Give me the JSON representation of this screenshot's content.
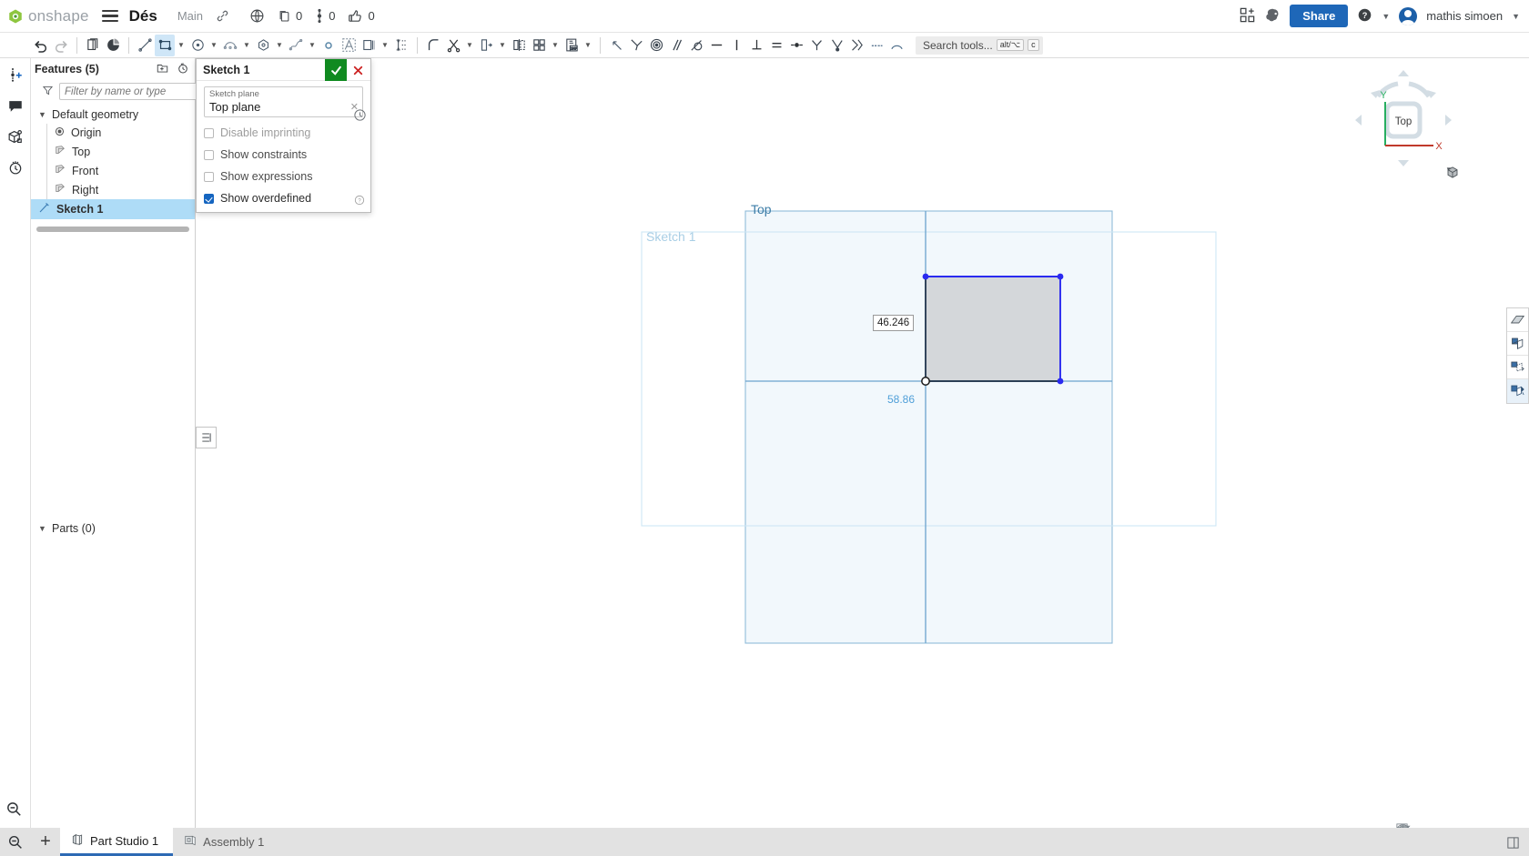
{
  "header": {
    "logo_text": "onshape",
    "logo_icon": "onshape-logo-icon",
    "menu_icon": "hamburger-menu-icon",
    "document_title": "Dés",
    "branch": "Main",
    "link_icon": "link-icon",
    "globe_icon": "globe-icon",
    "counters": [
      {
        "icon": "copy-versions-icon",
        "value": "0"
      },
      {
        "icon": "branch-point-icon",
        "value": "0"
      },
      {
        "icon": "thumbs-up-icon",
        "value": "0"
      }
    ],
    "apps_icon": "apps-grid-plus-icon",
    "ai_icon": "brain-ai-icon",
    "share_label": "Share",
    "help_icon": "help-circle-icon",
    "user_name": "mathis simoen",
    "avatar": "user-avatar"
  },
  "toolbar": {
    "groups": [
      {
        "items": [
          {
            "icon": "undo-icon",
            "name": "undo-button",
            "active": false
          },
          {
            "icon": "redo-icon",
            "name": "redo-button",
            "active": false,
            "dim": true
          }
        ]
      },
      {
        "items": [
          {
            "icon": "copy-icon",
            "name": "copy-button",
            "active": false
          },
          {
            "icon": "paste-icon",
            "name": "paste-button",
            "active": false
          }
        ]
      },
      {
        "items": [
          {
            "icon": "line-icon",
            "name": "line-tool",
            "active": false
          },
          {
            "icon": "rectangle-icon",
            "name": "rectangle-tool",
            "active": true,
            "dropdown": true
          },
          {
            "icon": "circle-icon",
            "name": "circle-tool",
            "active": false,
            "dropdown": true
          },
          {
            "icon": "arc-icon",
            "name": "arc-tool",
            "active": false,
            "dropdown": true
          },
          {
            "icon": "polygon-icon",
            "name": "polygon-tool",
            "active": false,
            "dropdown": true
          },
          {
            "icon": "spline-icon",
            "name": "spline-tool",
            "active": false,
            "dropdown": true
          },
          {
            "icon": "point-icon",
            "name": "point-tool",
            "active": false
          },
          {
            "icon": "text-icon",
            "name": "text-tool",
            "active": false
          },
          {
            "icon": "offset-icon",
            "name": "offset-tool",
            "active": false,
            "dropdown": true
          },
          {
            "icon": "dimension-icon",
            "name": "dimension-tool",
            "active": false
          }
        ]
      },
      {
        "items": [
          {
            "icon": "fillet-icon",
            "name": "fillet-tool",
            "active": false
          },
          {
            "icon": "trim-scissors-icon",
            "name": "trim-tool",
            "active": false,
            "dropdown": true
          },
          {
            "icon": "extend-icon",
            "name": "extend-tool",
            "active": false,
            "dropdown": true
          },
          {
            "icon": "mirror-icon",
            "name": "mirror-tool",
            "active": false
          },
          {
            "icon": "pattern-grid-icon",
            "name": "pattern-tool",
            "active": false,
            "dropdown": true
          },
          {
            "icon": "dxf-import-icon",
            "name": "import-dxf-tool",
            "active": false,
            "dropdown": true
          }
        ]
      },
      {
        "items": [
          {
            "icon": "construction-toggle-icon",
            "name": "construction-toggle",
            "active": false
          },
          {
            "icon": "coincident-constraint-icon",
            "name": "coincident-constraint",
            "active": false
          },
          {
            "icon": "concentric-constraint-icon",
            "name": "concentric-constraint",
            "active": false
          },
          {
            "icon": "parallel-constraint-icon",
            "name": "parallel-constraint",
            "active": false
          },
          {
            "icon": "tangent-constraint-icon",
            "name": "tangent-constraint",
            "active": false
          },
          {
            "icon": "horizontal-constraint-icon",
            "name": "horizontal-constraint",
            "active": false
          },
          {
            "icon": "vertical-constraint-icon",
            "name": "vertical-constraint",
            "active": false
          },
          {
            "icon": "perpendicular-constraint-icon",
            "name": "perpendicular-constraint",
            "active": false
          },
          {
            "icon": "equal-constraint-icon",
            "name": "equal-constraint",
            "active": false
          },
          {
            "icon": "midpoint-constraint-icon",
            "name": "midpoint-constraint",
            "active": false
          },
          {
            "icon": "symmetric-constraint-icon",
            "name": "symmetric-constraint",
            "active": false
          },
          {
            "icon": "pierce-constraint-icon",
            "name": "pierce-constraint",
            "active": false
          },
          {
            "icon": "curve-pattern-icon",
            "name": "curve-pattern-tool",
            "active": false
          },
          {
            "icon": "normal-constraint-icon",
            "name": "normal-constraint",
            "active": false
          },
          {
            "icon": "sketch-fix-icon",
            "name": "sketch-fix-tool",
            "active": false
          }
        ]
      }
    ],
    "search_placeholder": "Search tools...",
    "search_kbd": [
      "alt/⌥",
      "c"
    ]
  },
  "left_rail": {
    "items": [
      {
        "icon": "insert-feature-icon",
        "name": "rail-insert-feature"
      },
      {
        "icon": "comment-bubble-icon",
        "name": "rail-comments"
      },
      {
        "icon": "part-properties-icon",
        "name": "rail-part-properties"
      },
      {
        "icon": "history-clock-icon",
        "name": "rail-history"
      }
    ],
    "bottom_icon": "zoom-search-icon"
  },
  "feature_panel": {
    "title": "Features (5)",
    "header_icons": [
      {
        "icon": "new-folder-icon",
        "name": "new-folder-button"
      },
      {
        "icon": "rollback-clock-icon",
        "name": "rollback-button"
      }
    ],
    "filter_icon": "funnel-filter-icon",
    "filter_placeholder": "Filter by name or type",
    "filter_value": "",
    "tree": {
      "group_label": "Default geometry",
      "items": [
        {
          "label": "Origin",
          "icon": "origin-icon",
          "selected": false
        },
        {
          "label": "Top",
          "icon": "plane-icon",
          "selected": false
        },
        {
          "label": "Front",
          "icon": "plane-icon",
          "selected": false
        },
        {
          "label": "Right",
          "icon": "plane-icon",
          "selected": false
        }
      ],
      "sketch": {
        "label": "Sketch 1",
        "icon": "sketch-icon",
        "selected": true
      }
    },
    "parts_label": "Parts (0)"
  },
  "dialog": {
    "title": "Sketch 1",
    "accept_icon": "checkmark-icon",
    "cancel_icon": "close-x-icon",
    "clock_icon": "history-clock-icon",
    "help_icon": "help-question-icon",
    "plane_field": {
      "label": "Sketch plane",
      "value": "Top plane",
      "clear_icon": "clear-x-icon"
    },
    "options": [
      {
        "label": "Disable imprinting",
        "checked": false,
        "disabled": true,
        "name": "disable-imprinting-checkbox"
      },
      {
        "label": "Show constraints",
        "checked": false,
        "disabled": false,
        "name": "show-constraints-checkbox"
      },
      {
        "label": "Show expressions",
        "checked": false,
        "disabled": false,
        "name": "show-expressions-checkbox"
      },
      {
        "label": "Show overdefined",
        "checked": true,
        "disabled": false,
        "name": "show-overdefined-checkbox"
      }
    ]
  },
  "canvas": {
    "plane_label": "Top",
    "sketch_label": "Sketch 1",
    "dimensions": {
      "vertical_value": "46.246",
      "horizontal_value": "58.86"
    },
    "colors": {
      "sketch_edge": "#2a2af0",
      "sketch_fill": "#d4d7da",
      "plane_border": "#8fbcd9",
      "plane_fill": "#f2f8fc",
      "dimension_text": "#4f9fd8"
    },
    "view_cube": {
      "face_label": "Top",
      "axis_x_label": "X",
      "axis_y_label": "Y",
      "axis_x_color": "#c0392b",
      "axis_y_color": "#27ae60",
      "dropdown_icon": "view-cube-dropdown-icon"
    },
    "display_buttons": [
      {
        "icon": "shaded-view-icon",
        "name": "display-shaded",
        "selected": false
      },
      {
        "icon": "section-view-icon",
        "name": "display-section",
        "selected": false
      },
      {
        "icon": "hidden-lines-icon",
        "name": "display-hidden-lines",
        "selected": false
      },
      {
        "icon": "sketch-display-icon",
        "name": "display-sketch-entities",
        "selected": true
      }
    ],
    "bottom_icons": [
      {
        "icon": "measure-icon",
        "name": "measure-tool"
      },
      {
        "icon": "mass-properties-icon",
        "name": "mass-properties-tool"
      },
      {
        "icon": "panel-layout-icon",
        "name": "panel-layout-toggle"
      }
    ],
    "list_button_icon": "feature-list-icon"
  },
  "tabbar": {
    "zoom_icon": "zoom-search-icon",
    "add_label": "+",
    "tabs": [
      {
        "label": "Part Studio 1",
        "icon": "part-studio-icon",
        "active": true
      },
      {
        "label": "Assembly 1",
        "icon": "assembly-icon",
        "active": false
      }
    ]
  }
}
